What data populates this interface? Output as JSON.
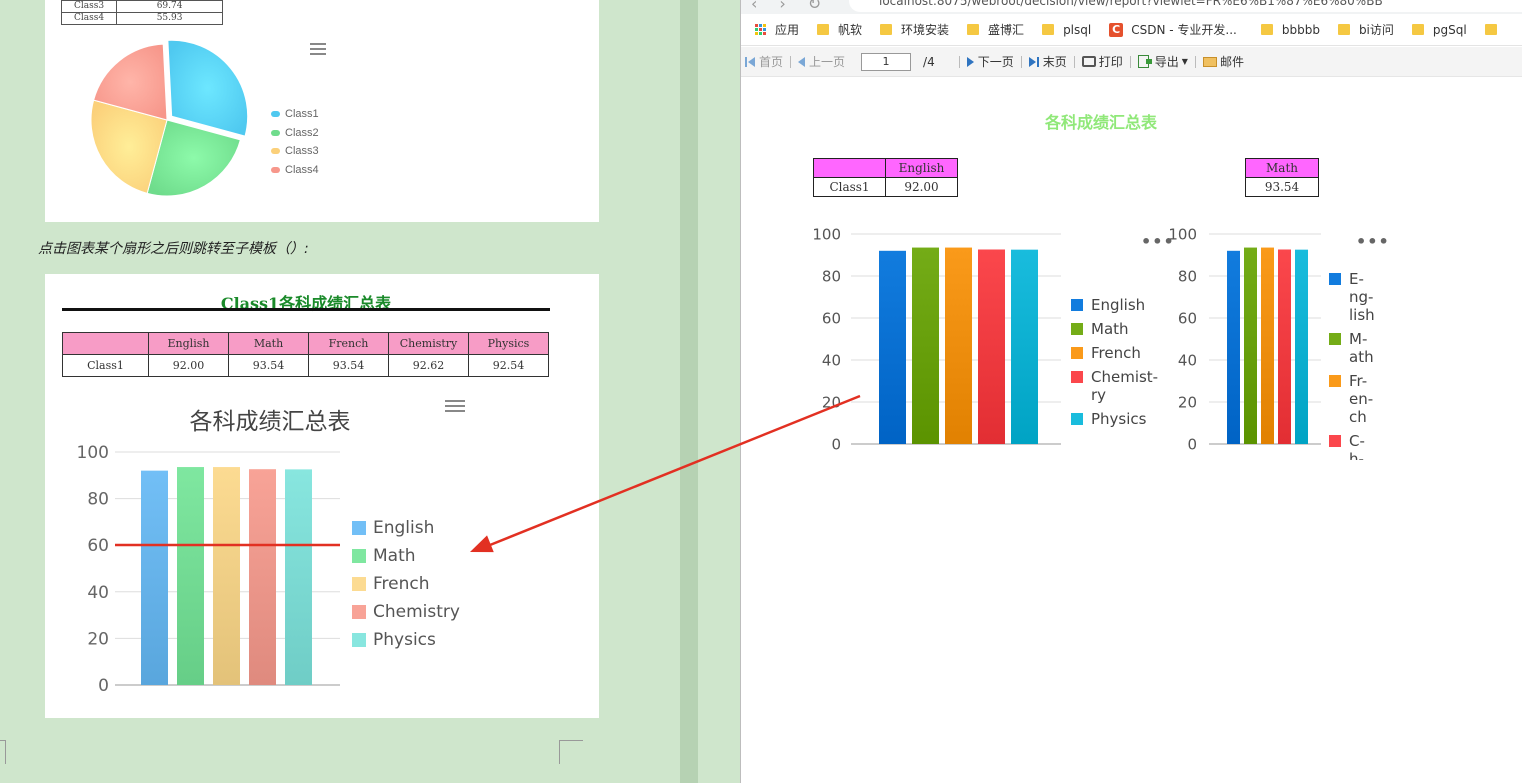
{
  "colors": {
    "page_bg": "#cfe6cc",
    "arrow": "#e23022",
    "report_title_left": "#1a8a2a",
    "report_title_right": "#90e879",
    "header_pink": "#f79cc6",
    "header_magenta": "#ff66ff"
  },
  "left_document": {
    "mini_table": {
      "rows": [
        {
          "label": "Class3",
          "value": "69.74"
        },
        {
          "label": "Class4",
          "value": "55.93"
        }
      ]
    },
    "pie_chart": {
      "menu_icon": "hamburger-menu-icon",
      "legend": [
        {
          "label": "Class1",
          "color": "#4fc9f0"
        },
        {
          "label": "Class2",
          "color": "#6fdc8c"
        },
        {
          "label": "Class3",
          "color": "#fbd07a"
        },
        {
          "label": "Class4",
          "color": "#f7978b"
        }
      ]
    },
    "caption": "点击图表某个扇形之后则跳转至子模板（）:",
    "report": {
      "title": "Class1各科成绩汇总表",
      "table": {
        "headers": [
          "",
          "English",
          "Math",
          "French",
          "Chemistry",
          "Physics"
        ],
        "row": [
          "Class1",
          "92.00",
          "93.54",
          "93.54",
          "92.62",
          "92.54"
        ]
      },
      "chart_title": "各科成绩汇总表",
      "menu_icon": "hamburger-menu-icon",
      "legend": [
        {
          "label": "English",
          "color": "#72bff6"
        },
        {
          "label": "Math",
          "color": "#7fe7a0"
        },
        {
          "label": "French",
          "color": "#fcdb92"
        },
        {
          "label": "Chemistry",
          "color": "#f8a397"
        },
        {
          "label": "Physics",
          "color": "#88e6df"
        }
      ]
    }
  },
  "browser": {
    "address": "localhost:8075/webroot/decision/view/report?viewlet=FR%E6%B1%87%E6%80%BB",
    "bookmarks": [
      {
        "label": "应用",
        "icon": "apps-grid-icon"
      },
      {
        "label": "帆软",
        "icon": "folder-icon"
      },
      {
        "label": "环境安装",
        "icon": "folder-icon"
      },
      {
        "label": "盛博汇",
        "icon": "folder-icon"
      },
      {
        "label": "plsql",
        "icon": "folder-icon"
      },
      {
        "label": "CSDN - 专业开发...",
        "icon": "csdn-icon"
      },
      {
        "label": "bbbbb",
        "icon": "folder-icon"
      },
      {
        "label": "bi访问",
        "icon": "folder-icon"
      },
      {
        "label": "pgSql",
        "icon": "folder-icon"
      }
    ],
    "toolbar": {
      "first": "首页",
      "prev": "上一页",
      "page_value": "1",
      "page_total": "/4",
      "next": "下一页",
      "last": "末页",
      "print": "打印",
      "export": "导出",
      "email": "邮件"
    },
    "report_title": "各科成绩汇总表",
    "table_left": {
      "headers": [
        "",
        "English"
      ],
      "row": [
        "Class1",
        "92.00"
      ]
    },
    "table_right": {
      "headers": [
        "Math"
      ],
      "row": [
        "93.54"
      ]
    },
    "chart_left_legend": [
      {
        "label": "English",
        "color": "#127cde"
      },
      {
        "label": "Math",
        "color": "#74ac17"
      },
      {
        "label": "French",
        "color": "#fa9a1a"
      },
      {
        "label": "Chemist-\nry",
        "color": "#fb474c"
      },
      {
        "label": "Physics",
        "color": "#19bcdd"
      }
    ],
    "chart_right_legend": [
      {
        "label": "E-\nng-\nlish",
        "color": "#127cde"
      },
      {
        "label": "M-\nath",
        "color": "#74ac17"
      },
      {
        "label": "Fr-\nen-\nch",
        "color": "#fa9a1a"
      },
      {
        "label": "C-\nh-",
        "color": "#fb474c"
      }
    ],
    "more_icon": "more-dots-icon"
  },
  "chart_data": [
    {
      "type": "pie",
      "categories": [
        "Class1",
        "Class2",
        "Class3",
        "Class4"
      ],
      "values": [
        30,
        25,
        25,
        20
      ],
      "legend_position": "right"
    },
    {
      "type": "bar",
      "title": "各科成绩汇总表",
      "categories": [
        "English",
        "Math",
        "French",
        "Chemistry",
        "Physics"
      ],
      "values": [
        92.0,
        93.54,
        93.54,
        92.62,
        92.54
      ],
      "ylim": [
        0,
        100
      ],
      "yticks": [
        0,
        20,
        40,
        60,
        80,
        100
      ],
      "grid": true,
      "legend_position": "right"
    },
    {
      "type": "bar",
      "categories": [
        "English",
        "Math",
        "French",
        "Chemistry",
        "Physics"
      ],
      "values": [
        92.0,
        93.54,
        93.54,
        92.62,
        92.54
      ],
      "ylim": [
        0,
        100
      ],
      "yticks": [
        0,
        20,
        40,
        60,
        80,
        100
      ],
      "grid": true,
      "legend_position": "right"
    },
    {
      "type": "bar",
      "categories": [
        "English",
        "Math",
        "French",
        "Chemistry",
        "Physics"
      ],
      "values": [
        92.0,
        93.54,
        93.54,
        92.62,
        92.54
      ],
      "ylim": [
        0,
        100
      ],
      "yticks": [
        0,
        20,
        40,
        60,
        80,
        100
      ],
      "grid": true,
      "legend_position": "right"
    }
  ]
}
